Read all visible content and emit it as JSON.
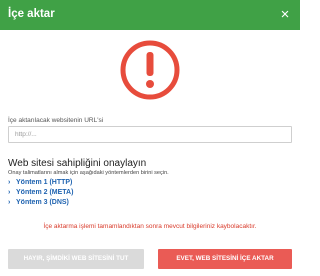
{
  "dialog": {
    "title": "İçe aktar",
    "close_glyph": "×",
    "icon": "exclamation-circle-icon",
    "accent_color": "#40a146",
    "danger_color": "#e74c3c"
  },
  "url_field": {
    "label": "İçe aktarılacak websitenin URL'si",
    "placeholder": "http://...",
    "value": ""
  },
  "verify": {
    "title": "Web sitesi sahipliğini onaylayın",
    "description": "Onay talimatlarını almak için aşağıdaki yöntemlerden birini seçin.",
    "methods": [
      {
        "label": "Yöntem 1 (HTTP)"
      },
      {
        "label": "Yöntem 2 (META)"
      },
      {
        "label": "Yöntem 3 (DNS)"
      }
    ]
  },
  "warning": "İçe aktarma işlemi tamamlandıktan sonra mevcut bilgileriniz kaybolacaktır.",
  "buttons": {
    "cancel": "HAYIR, ŞİMDİKİ WEB SİTESİNİ TUT",
    "confirm": "EVET, WEB SİTESİNİ İÇE AKTAR"
  }
}
